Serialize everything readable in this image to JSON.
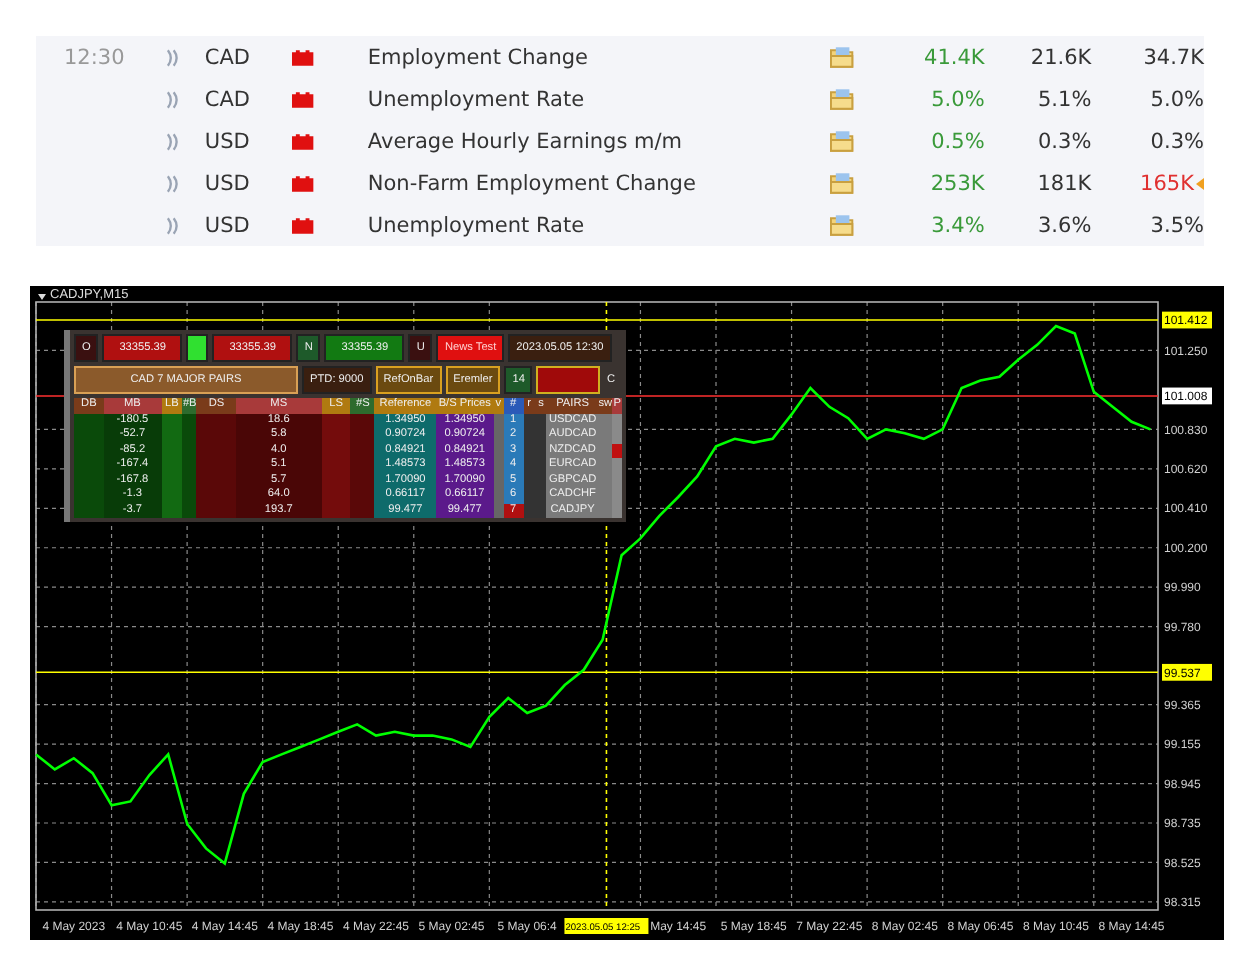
{
  "calendar": {
    "rows": [
      {
        "time": "12:30",
        "currency": "CAD",
        "event": "Employment Change",
        "actual": "41.4K",
        "forecast": "21.6K",
        "previous": "34.7K",
        "previous_revised": false
      },
      {
        "currency": "CAD",
        "event": "Unemployment Rate",
        "actual": "5.0%",
        "forecast": "5.1%",
        "previous": "5.0%",
        "previous_revised": false
      },
      {
        "currency": "USD",
        "event": "Average Hourly Earnings m/m",
        "actual": "0.5%",
        "forecast": "0.3%",
        "previous": "0.3%",
        "previous_revised": false
      },
      {
        "currency": "USD",
        "event": "Non-Farm Employment Change",
        "actual": "253K",
        "forecast": "181K",
        "previous": "165K",
        "previous_revised": true
      },
      {
        "currency": "USD",
        "event": "Unemployment Rate",
        "actual": "3.4%",
        "forecast": "3.6%",
        "previous": "3.5%",
        "previous_revised": false
      }
    ]
  },
  "chart": {
    "title": "CADJPY,M15",
    "panel": {
      "top_row": [
        {
          "kind": "label",
          "text": "O"
        },
        {
          "kind": "sell",
          "text": "33355.39"
        },
        {
          "kind": "indicator"
        },
        {
          "kind": "sell",
          "text": "33355.39"
        },
        {
          "kind": "label-green",
          "text": "N"
        },
        {
          "kind": "buy",
          "text": "33355.39"
        },
        {
          "kind": "label",
          "text": "U"
        },
        {
          "kind": "alert",
          "text": "News Test"
        },
        {
          "kind": "date",
          "text": "2023.05.05 12:30"
        }
      ],
      "second_row": [
        {
          "kind": "title",
          "text": "CAD 7 MAJOR PAIRS"
        },
        {
          "kind": "date",
          "text": "PTD: 9000"
        },
        {
          "kind": "gold",
          "text": "RefOnBar"
        },
        {
          "kind": "gold",
          "text": "Eremler"
        },
        {
          "kind": "label-green",
          "text": "14"
        },
        {
          "kind": "alarm"
        },
        {
          "kind": "plain",
          "text": "C"
        }
      ],
      "headers": [
        "DB",
        "MB",
        "LB",
        "#B",
        "DS",
        "MS",
        "LS",
        "#S",
        "Reference",
        "B/S Prices",
        "v",
        "#",
        "r",
        "s",
        "PAIRS",
        "sw",
        "P"
      ],
      "rows": [
        {
          "mb": "-180.5",
          "ms": "18.6",
          "ref": "1.34950",
          "bs": "1.34950",
          "num": {
            "text": "1",
            "color": "#2a7ab8"
          },
          "pair": "USDCAD",
          "p": {
            "color": "#8a8a8a"
          }
        },
        {
          "mb": "-52.7",
          "ms": "5.8",
          "ref": "0.90724",
          "bs": "0.90724",
          "num": {
            "text": "2",
            "color": "#2a7ab8"
          },
          "pair": "AUDCAD",
          "p": {
            "color": "#8a8a8a"
          }
        },
        {
          "mb": "-85.2",
          "ms": "4.0",
          "ref": "0.84921",
          "bs": "0.84921",
          "num": {
            "text": "3",
            "color": "#2a7ab8"
          },
          "pair": "NZDCAD",
          "p": {
            "color": "#c01010"
          }
        },
        {
          "mb": "-167.4",
          "ms": "5.1",
          "ref": "1.48573",
          "bs": "1.48573",
          "num": {
            "text": "4",
            "color": "#2a7ab8"
          },
          "pair": "EURCAD",
          "p": {
            "color": "#8a8a8a"
          }
        },
        {
          "mb": "-167.8",
          "ms": "5.7",
          "ref": "1.70090",
          "bs": "1.70090",
          "num": {
            "text": "5",
            "color": "#2a7ab8"
          },
          "pair": "GBPCAD",
          "p": {
            "color": "#8a8a8a"
          }
        },
        {
          "mb": "-1.3",
          "ms": "64.0",
          "ref": "0.66117",
          "bs": "0.66117",
          "num": {
            "text": "6",
            "color": "#2a7ab8"
          },
          "pair": "CADCHF",
          "p": {
            "color": "#8a8a8a"
          }
        },
        {
          "mb": "-3.7",
          "ms": "193.7",
          "ref": "99.477",
          "bs": "99.477",
          "num": {
            "text": "7",
            "color": "#b01010"
          },
          "pair": "CADJPY",
          "p": {
            "color": "#8a8a8a"
          }
        }
      ]
    },
    "chart_data": {
      "type": "line",
      "grid": true,
      "ylim": [
        98.272,
        101.508
      ],
      "categories": [
        null,
        null,
        "4 May 2023",
        null,
        null,
        null,
        "4 May 10:45",
        null,
        null,
        null,
        "4 May 14:45",
        null,
        null,
        null,
        "4 May 18:45",
        null,
        null,
        null,
        "4 May 22:45",
        null,
        null,
        null,
        "5 May 02:45",
        null,
        null,
        null,
        "5 May 06:4",
        null,
        null,
        null,
        null,
        null,
        null,
        null,
        "May 14:45",
        null,
        null,
        null,
        "5 May 18:45",
        null,
        null,
        null,
        "7 May 22:45",
        null,
        null,
        null,
        "8 May 02:45",
        null,
        null,
        null,
        "8 May 06:45",
        null,
        null,
        null,
        "8 May 10:45",
        null,
        null,
        null,
        "8 May 14:45",
        null
      ],
      "series": [
        {
          "color": "#00ff00",
          "values": [
            99.1,
            99.02,
            99.08,
            99.0,
            98.83,
            98.85,
            98.99,
            99.1,
            98.73,
            98.6,
            98.52,
            98.89,
            99.06,
            99.1,
            99.14,
            99.18,
            99.22,
            99.26,
            99.2,
            99.22,
            99.2,
            99.2,
            99.18,
            99.14,
            99.3,
            99.4,
            99.32,
            99.36,
            99.47,
            99.55,
            99.71,
            100.16,
            100.25,
            100.37,
            100.47,
            100.58,
            100.74,
            100.78,
            100.76,
            100.78,
            100.91,
            101.05,
            100.95,
            100.89,
            100.78,
            100.83,
            100.81,
            100.78,
            100.83,
            101.05,
            101.09,
            101.11,
            101.2,
            101.28,
            101.38,
            101.34,
            101.03,
            100.95,
            100.87,
            100.83
          ]
        }
      ],
      "yticks": [
        {
          "value": 101.25,
          "label": "101.250"
        },
        {
          "value": 100.83,
          "label": "100.830"
        },
        {
          "value": 100.62,
          "label": "100.620"
        },
        {
          "value": 100.41,
          "label": "100.410"
        },
        {
          "value": 100.2,
          "label": "100.200"
        },
        {
          "value": 99.99,
          "label": "99.990"
        },
        {
          "value": 99.78,
          "label": "99.780"
        },
        {
          "value": 99.365,
          "label": "99.365"
        },
        {
          "value": 99.155,
          "label": "99.155"
        },
        {
          "value": 98.945,
          "label": "98.945"
        },
        {
          "value": 98.735,
          "label": "98.735"
        },
        {
          "value": 98.525,
          "label": "98.525"
        },
        {
          "value": 98.315,
          "label": "98.315"
        }
      ],
      "ref_lines": [
        {
          "axis": "y",
          "value": 101.412,
          "label": "101.412",
          "color": "#ffff00"
        },
        {
          "axis": "y",
          "value": 101.008,
          "label": "101.008",
          "color": "#ff3030"
        },
        {
          "axis": "y",
          "value": 99.537,
          "label": "99.537",
          "color": "#ffff00"
        }
      ]
    },
    "crosshair": {
      "label": "2023.05.05 12:25"
    }
  }
}
